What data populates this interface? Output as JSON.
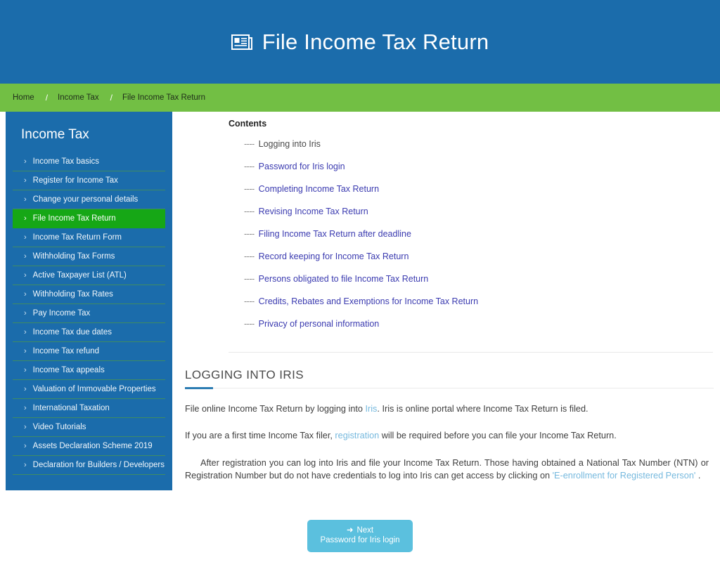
{
  "header": {
    "title": "File Income Tax Return",
    "icon": "newspaper-icon",
    "background_color": "#1b6cab"
  },
  "breadcrumb": {
    "separator": "/",
    "background_color": "#72bf44",
    "items": [
      {
        "label": "Home"
      },
      {
        "label": "Income Tax"
      },
      {
        "label": "File Income Tax Return"
      }
    ]
  },
  "sidebar": {
    "title": "Income Tax",
    "background_color": "#1b6cab",
    "active_color": "#16a716",
    "items": [
      {
        "label": "Income Tax basics",
        "active": false
      },
      {
        "label": "Register for Income Tax",
        "active": false
      },
      {
        "label": "Change your personal details",
        "active": false
      },
      {
        "label": "File Income Tax Return",
        "active": true
      },
      {
        "label": "Income Tax Return Form",
        "active": false
      },
      {
        "label": "Withholding Tax Forms",
        "active": false
      },
      {
        "label": "Active Taxpayer List (ATL)",
        "active": false
      },
      {
        "label": "Withholding Tax Rates",
        "active": false
      },
      {
        "label": "Pay Income Tax",
        "active": false
      },
      {
        "label": "Income Tax due dates",
        "active": false
      },
      {
        "label": "Income Tax refund",
        "active": false
      },
      {
        "label": "Income Tax appeals",
        "active": false
      },
      {
        "label": "Valuation of Immovable Properties",
        "active": false
      },
      {
        "label": "International Taxation",
        "active": false
      },
      {
        "label": "Video Tutorials",
        "active": false
      },
      {
        "label": "Assets Declaration Scheme 2019",
        "active": false
      },
      {
        "label": "Declaration for Builders / Developers",
        "active": false
      }
    ]
  },
  "contents": {
    "heading": "Contents",
    "dash": "----",
    "items": [
      {
        "label": "Logging into Iris",
        "current": true
      },
      {
        "label": "Password for Iris login",
        "current": false
      },
      {
        "label": "Completing Income Tax Return",
        "current": false
      },
      {
        "label": "Revising Income Tax Return",
        "current": false
      },
      {
        "label": "Filing Income Tax Return after deadline",
        "current": false
      },
      {
        "label": "Record keeping for Income Tax Return",
        "current": false
      },
      {
        "label": "Persons obligated to file Income Tax Return",
        "current": false
      },
      {
        "label": "Credits, Rebates and Exemptions for Income Tax Return",
        "current": false
      },
      {
        "label": "Privacy of personal information",
        "current": false
      }
    ]
  },
  "section": {
    "title": "LOGGING INTO IRIS",
    "accent_color": "#2d7db3",
    "paragraph1": {
      "before_link": "File online Income Tax Return by logging into ",
      "link": "Iris",
      "after_link": ". Iris is online portal where Income Tax Return is filed."
    },
    "paragraph2": {
      "before_link": "If you are a first time Income Tax filer, ",
      "link": "registration",
      "after_link": " will be required before you can file your Income Tax Return."
    },
    "paragraph3": {
      "before_link": "After registration you can log into Iris and file your Income Tax Return. Those having obtained a National Tax Number (NTN) or Registration Number but do not have credentials to log into Iris can get access by clicking on ",
      "link": "'E-enrollment for Registered Person'",
      "after_link": " ."
    }
  },
  "next_button": {
    "arrow": "➜",
    "label": "Next",
    "sublabel": "Password for Iris login",
    "background_color": "#5bc0de"
  }
}
